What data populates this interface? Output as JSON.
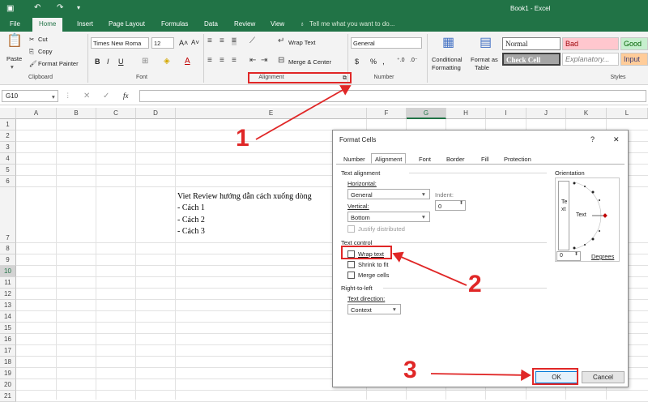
{
  "titlebar": {
    "doc": "Book1 - Excel"
  },
  "tabs": [
    "File",
    "Home",
    "Insert",
    "Page Layout",
    "Formulas",
    "Data",
    "Review",
    "View"
  ],
  "tellme": "Tell me what you want to do...",
  "clipboard": {
    "paste": "Paste",
    "cut": "Cut",
    "copy": "Copy",
    "painter": "Format Painter",
    "group": "Clipboard"
  },
  "font": {
    "name": "Times New Roma",
    "size": "12",
    "group": "Font",
    "bold": "B",
    "italic": "I",
    "underline": "U"
  },
  "alignment": {
    "wrap": "Wrap Text",
    "merge": "Merge & Center",
    "group": "Alignment"
  },
  "number": {
    "format": "General",
    "group": "Number",
    "currency": "$",
    "percent": "%",
    "comma": ","
  },
  "styles": {
    "conditional": "Conditional",
    "conditional2": "Formatting",
    "formatas": "Format as",
    "formatas2": "Table",
    "normal": "Normal",
    "bad": "Bad",
    "good": "Good",
    "check": "Check Cell",
    "explanatory": "Explanatory...",
    "input": "Input",
    "group": "Styles"
  },
  "formulabar": {
    "namebox": "G10",
    "fx": "fx"
  },
  "columns": [
    "A",
    "B",
    "C",
    "D",
    "E",
    "F",
    "G",
    "H",
    "I",
    "J",
    "K",
    "L"
  ],
  "rows": [
    "1",
    "2",
    "3",
    "4",
    "5",
    "6",
    "7",
    "8",
    "9",
    "10",
    "11",
    "12",
    "13",
    "14",
    "15",
    "16",
    "17",
    "18",
    "19",
    "20",
    "21"
  ],
  "cell_lines": [
    "Viet Review hướng dẫn cách xuống dòng",
    "- Cách 1",
    "- Cách 2",
    "- Cách 3"
  ],
  "dialog": {
    "title": "Format Cells",
    "help": "?",
    "close": "✕",
    "tabs": [
      "Number",
      "Alignment",
      "Font",
      "Border",
      "Fill",
      "Protection"
    ],
    "text_alignment": "Text alignment",
    "horizontal_label": "Horizontal:",
    "horizontal_value": "General",
    "vertical_label": "Vertical:",
    "vertical_value": "Bottom",
    "indent_label": "Indent:",
    "indent_value": "0",
    "justify": "Justify distributed",
    "text_control": "Text control",
    "wrap": "Wrap text",
    "shrink": "Shrink to fit",
    "merge": "Merge cells",
    "rtl": "Right-to-left",
    "direction_label": "Text direction:",
    "direction_value": "Context",
    "orientation": "Orientation",
    "vertical_text": "Text",
    "horiz_text": "Text",
    "degrees_value": "0",
    "degrees_label": "Degrees",
    "ok": "OK",
    "cancel": "Cancel"
  },
  "annotations": [
    "1",
    "2",
    "3"
  ]
}
